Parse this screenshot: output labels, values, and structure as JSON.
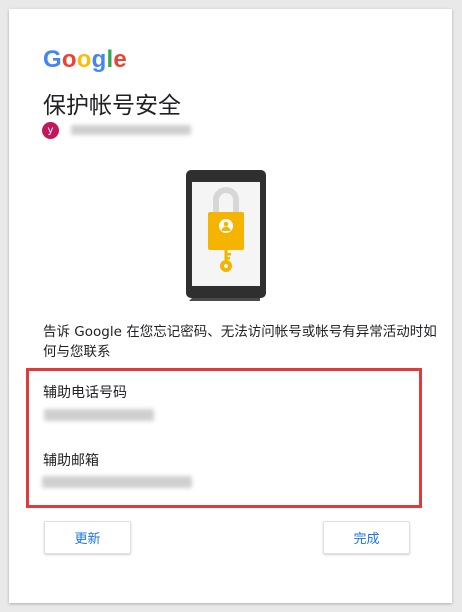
{
  "logo": {
    "letters": [
      {
        "ch": "G",
        "color": "#4285F4"
      },
      {
        "ch": "o",
        "color": "#EA4335"
      },
      {
        "ch": "o",
        "color": "#FBBC05"
      },
      {
        "ch": "g",
        "color": "#4285F4"
      },
      {
        "ch": "l",
        "color": "#34A853"
      },
      {
        "ch": "e",
        "color": "#EA4335"
      }
    ]
  },
  "page": {
    "title": "保护帐号安全",
    "avatar_initial": "y",
    "description": "告诉 Google 在您忘记密码、无法访问帐号或帐号有异常活动时如何与您联系"
  },
  "recovery": {
    "phone_label": "辅助电话号码",
    "email_label": "辅助邮箱"
  },
  "buttons": {
    "update": "更新",
    "done": "完成"
  },
  "colors": {
    "accent": "#1a73e8",
    "highlight_border": "#e03a3a",
    "lock_yellow": "#f4b400",
    "avatar": "#c2185b"
  }
}
